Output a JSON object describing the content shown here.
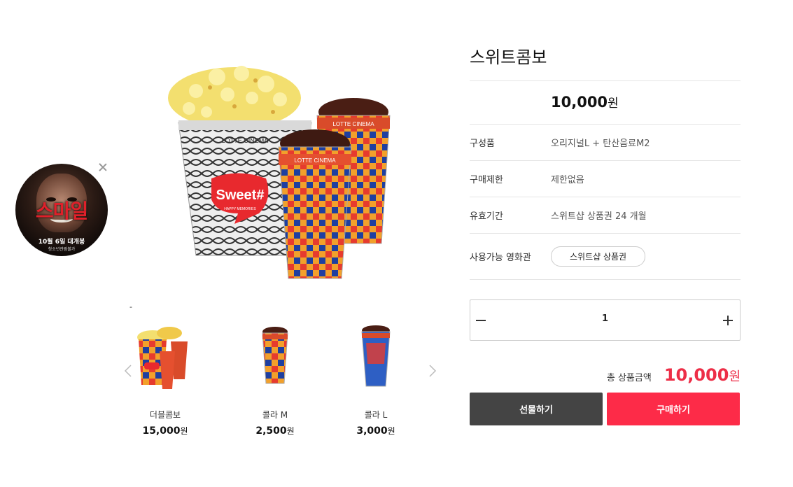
{
  "ad": {
    "title": "스마일",
    "line1": "10월 6일 대개봉",
    "line2": "청소년관람불가"
  },
  "main_image": {
    "tub_brand": "LOTTE CINEMA",
    "tub_logo": "Sweet#",
    "tub_tagline": "HAPPY MEMORIES",
    "cup_brand": "LOTTE CINEMA"
  },
  "carousel_marker": "-",
  "carousel": [
    {
      "name": "더블콤보",
      "price": "15,000",
      "won": "원"
    },
    {
      "name": "콜라 M",
      "price": "2,500",
      "won": "원"
    },
    {
      "name": "콜라 L",
      "price": "3,000",
      "won": "원"
    }
  ],
  "product": {
    "title": "스위트콤보",
    "price": "10,000",
    "won": "원",
    "rows": [
      {
        "label": "구성품",
        "value": "오리지널L + 탄산음료M2"
      },
      {
        "label": "구매제한",
        "value": "제한없음"
      },
      {
        "label": "유효기간",
        "value": "스위트샵 상품권 24 개월"
      }
    ],
    "theater_label": "사용가능 영화관",
    "theater_pill": "스위트샵 상품권"
  },
  "quantity": "1",
  "total": {
    "label": "총 상품금액",
    "value": "10,000",
    "won": "원"
  },
  "buttons": {
    "gift": "선물하기",
    "buy": "구매하기"
  },
  "colors": {
    "accent": "#fd2b48",
    "dark_button": "#444444"
  }
}
